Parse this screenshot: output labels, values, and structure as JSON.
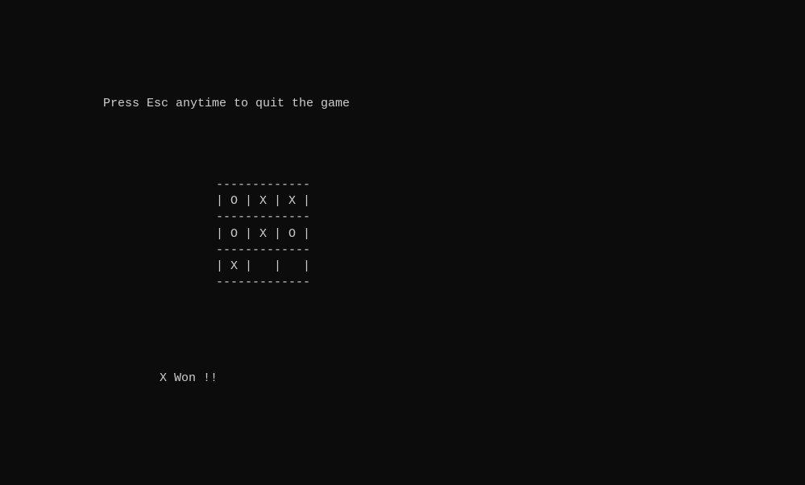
{
  "header": {
    "instruction": "Press Esc anytime to quit the game"
  },
  "board": {
    "separator": "-------------",
    "rows": [
      "| O | X | X |",
      "| O | X | O |",
      "| X |   |   |"
    ],
    "cells": [
      [
        "O",
        "X",
        "X"
      ],
      [
        "O",
        "X",
        "O"
      ],
      [
        "X",
        " ",
        " "
      ]
    ]
  },
  "result": {
    "message": "X Won !!"
  }
}
